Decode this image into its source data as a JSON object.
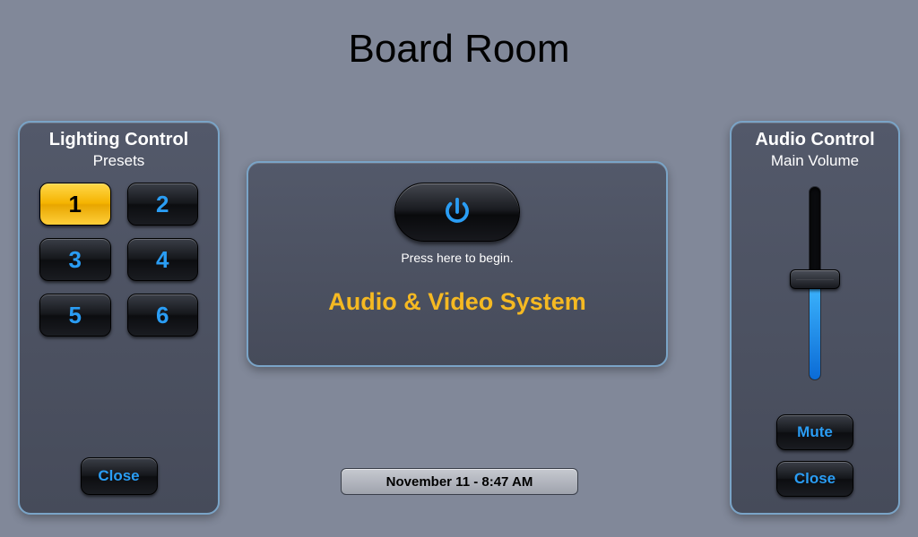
{
  "title": "Board Room",
  "lighting": {
    "title": "Lighting Control",
    "subtitle": "Presets",
    "presets": [
      {
        "label": "1",
        "active": true
      },
      {
        "label": "2",
        "active": false
      },
      {
        "label": "3",
        "active": false
      },
      {
        "label": "4",
        "active": false
      },
      {
        "label": "5",
        "active": false
      },
      {
        "label": "6",
        "active": false
      }
    ],
    "close_label": "Close"
  },
  "center": {
    "press_label": "Press here to begin.",
    "system_label": "Audio & Video System",
    "power_icon": "power-icon"
  },
  "datetime": "November 11  -  8:47 AM",
  "audio": {
    "title": "Audio Control",
    "subtitle": "Main Volume",
    "volume_percent": 52,
    "mute_label": "Mute",
    "close_label": "Close"
  },
  "colors": {
    "accent_blue": "#2a9df4",
    "accent_amber": "#f5b300"
  }
}
